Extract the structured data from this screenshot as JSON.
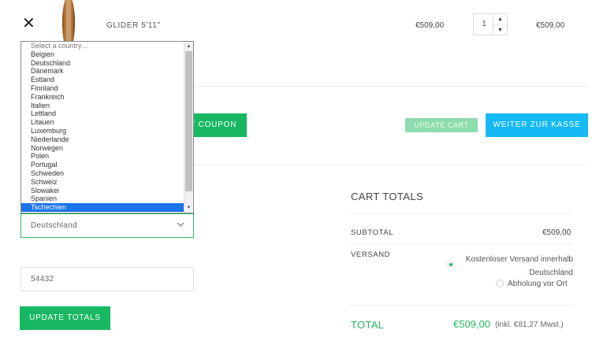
{
  "cart_item": {
    "remove_symbol": "✕",
    "name": "GLIDER 5'11\"",
    "price": "€509,00",
    "quantity": "1",
    "subtotal": "€509,00"
  },
  "actions": {
    "coupon_label": "Y COUPON",
    "update_cart_label": "UPDATE CART",
    "checkout_label": "WEITER ZUR KASSE",
    "update_totals_label": "UPDATE TOTALS"
  },
  "country_dropdown": {
    "options": [
      "Select a country…",
      "Belgien",
      "Deutschland",
      "Dänemark",
      "Estland",
      "Finnland",
      "Frankreich",
      "Italien",
      "Lettland",
      "Litauen",
      "Luxemburg",
      "Niederlande",
      "Norwegen",
      "Polen",
      "Portugal",
      "Schweden",
      "Schweiz",
      "Slowakei",
      "Spanien",
      "Tschechien"
    ],
    "highlighted_index": 19,
    "selected_value": "Deutschland"
  },
  "postcode": {
    "value": "54432"
  },
  "cart_totals": {
    "title": "CART TOTALS",
    "subtotal_label": "SUBTOTAL",
    "subtotal_value": "€509,00",
    "shipping_label": "VERSAND",
    "shipping_option_1_line1": "Kostenloser Versand innerhalb",
    "shipping_option_1_line2": "Deutschland",
    "shipping_option_2": "Abholung vor Ort",
    "total_label": "TOTAL",
    "total_value": "€509,00",
    "total_tax_note": "(inkl. €81,27 Mwst.)"
  },
  "colors": {
    "accent_green": "#18b862",
    "checkout_blue": "#15b9f3",
    "highlight_blue": "#1a73e8"
  },
  "icons": {
    "remove": "close-icon",
    "qty_up": "chevron-up-icon",
    "qty_down": "chevron-down-icon",
    "select_chevron": "chevron-down-icon"
  }
}
